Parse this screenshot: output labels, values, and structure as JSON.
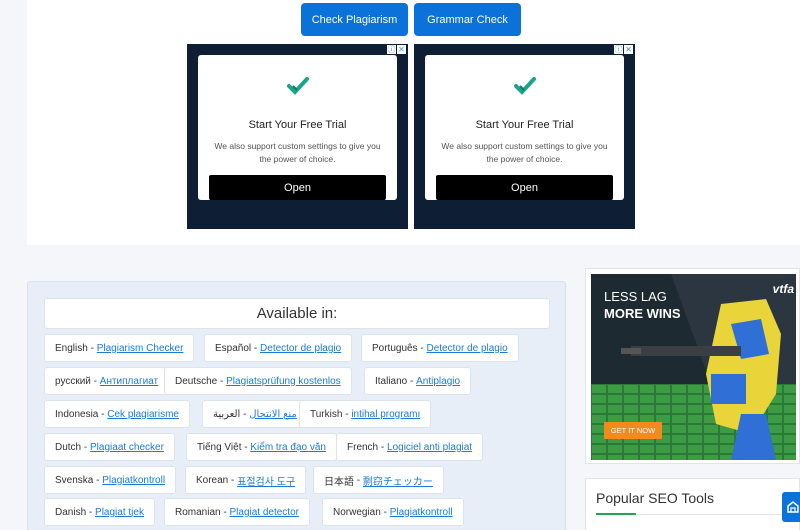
{
  "actions": {
    "check_label": "Check Plagiarism",
    "grammar_label": "Grammar Check"
  },
  "ads": [
    {
      "title": "Start Your Free Trial",
      "desc": "We also support custom settings to give you the power of choice.",
      "button": "Open"
    },
    {
      "title": "Start Your Free Trial",
      "desc": "We also support custom settings to give you the power of choice.",
      "button": "Open"
    }
  ],
  "available": {
    "title": "Available in:",
    "langs": [
      {
        "name": "English",
        "link": "Plagiarism Checker"
      },
      {
        "name": "Español",
        "link": "Detector de plagio"
      },
      {
        "name": "Português",
        "link": "Detector de plagio"
      },
      {
        "name": "русский",
        "link": "Антиплагиат"
      },
      {
        "name": "Deutsche",
        "link": "Plagiatsprüfung kostenlos"
      },
      {
        "name": "Italiano",
        "link": "Antiplagio"
      },
      {
        "name": "Indonesia",
        "link": "Cek plagiarisme"
      },
      {
        "name": "العربية",
        "link": "منع الانتحال"
      },
      {
        "name": "Turkish",
        "link": "intihal programı"
      },
      {
        "name": "Dutch",
        "link": "Plagiaat checker"
      },
      {
        "name": "Tiếng Việt",
        "link": "Kiểm tra đạo văn"
      },
      {
        "name": "French",
        "link": "Logiciel anti plagiat"
      },
      {
        "name": "Svenska",
        "link": "Plagiatkontroll"
      },
      {
        "name": "Korean",
        "link": "표절검사 도구"
      },
      {
        "name": "日本語",
        "link": "剽窃チェッカー"
      },
      {
        "name": "Danish",
        "link": "Plagiat tjek"
      },
      {
        "name": "Romanian",
        "link": "Plagiat detector"
      },
      {
        "name": "Norwegian",
        "link": "Plagiatkontroll"
      }
    ]
  },
  "banner": {
    "line1": "LESS LAG",
    "line2": "MORE WINS",
    "brand": "vtfa",
    "cta": "GET IT NOW"
  },
  "sidebar": {
    "popular_title": "Popular SEO Tools"
  },
  "icons": {
    "check": "checkmark-icon",
    "ad_info": "ad-info-icon",
    "ad_close": "close-icon",
    "fab": "share-icon"
  },
  "colors": {
    "accent": "#0a72d8",
    "link": "#1a7bd8",
    "check": "#1aa58a",
    "banner_cta": "#f28a1c"
  }
}
